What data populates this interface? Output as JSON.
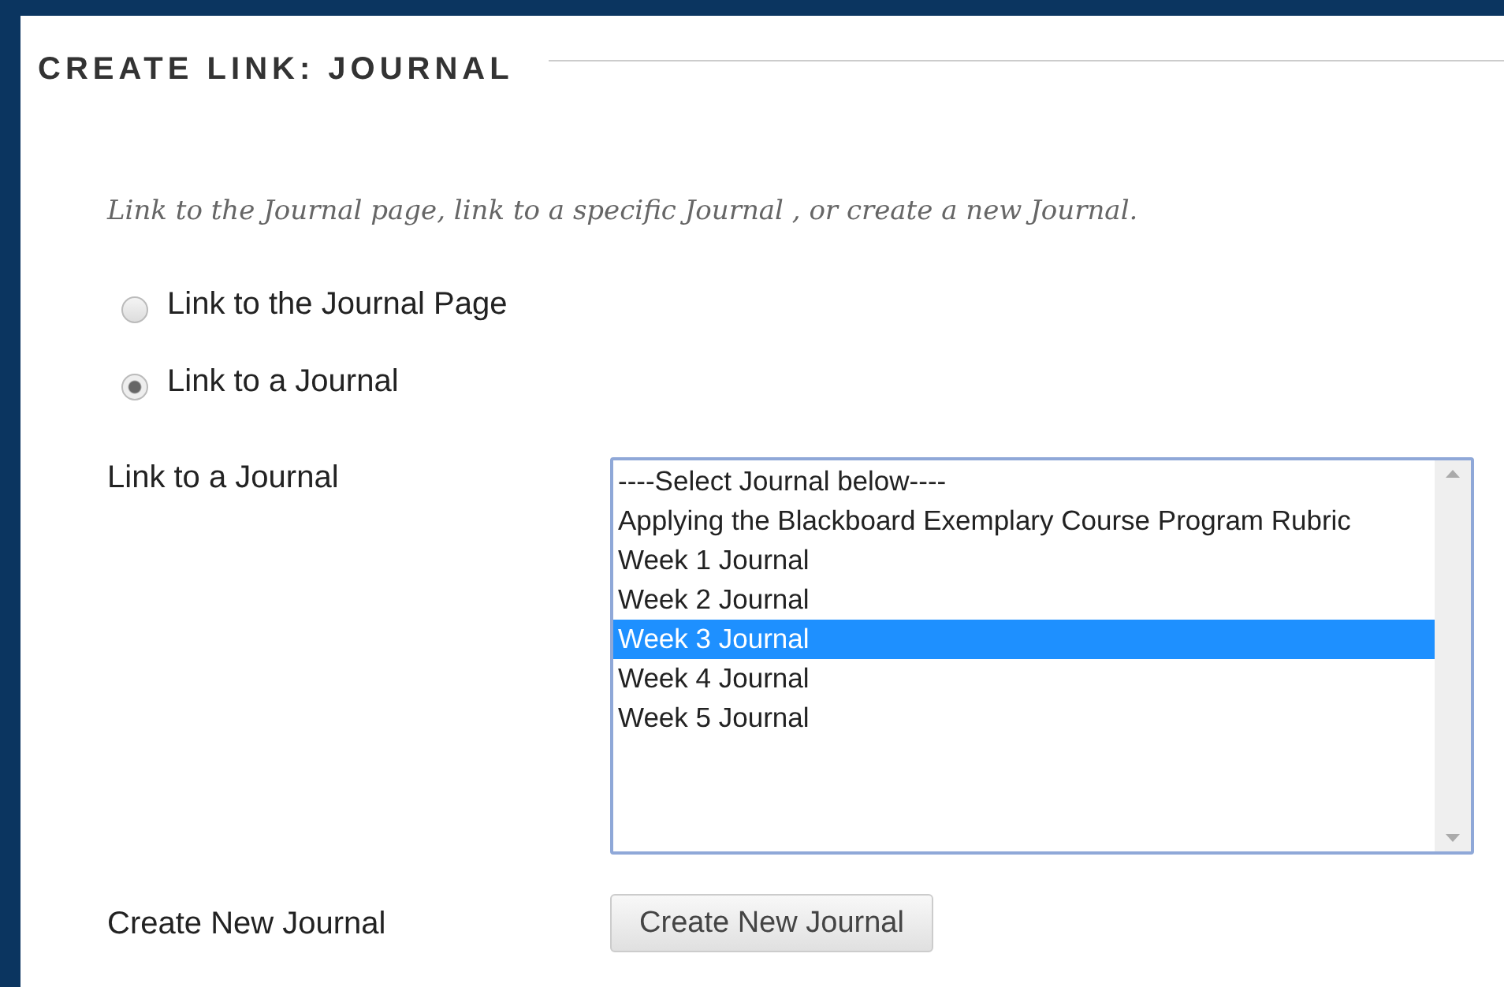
{
  "heading": "CREATE LINK: JOURNAL",
  "instructions": "Link to the Journal page, link to a specific Journal , or create a new Journal.",
  "options": [
    {
      "label": "Link to the Journal Page",
      "selected": false
    },
    {
      "label": "Link to a Journal",
      "selected": true
    }
  ],
  "journal_select": {
    "label": "Link to a Journal",
    "items": [
      {
        "label": "----Select Journal below----",
        "selected": false
      },
      {
        "label": "Applying the Blackboard Exemplary Course Program Rubric",
        "selected": false
      },
      {
        "label": "Week 1 Journal",
        "selected": false
      },
      {
        "label": "Week 2 Journal",
        "selected": false
      },
      {
        "label": "Week 3 Journal",
        "selected": true
      },
      {
        "label": "Week 4 Journal",
        "selected": false
      },
      {
        "label": "Week 5 Journal",
        "selected": false
      }
    ]
  },
  "create_new": {
    "label": "Create New Journal",
    "button": "Create New Journal"
  }
}
